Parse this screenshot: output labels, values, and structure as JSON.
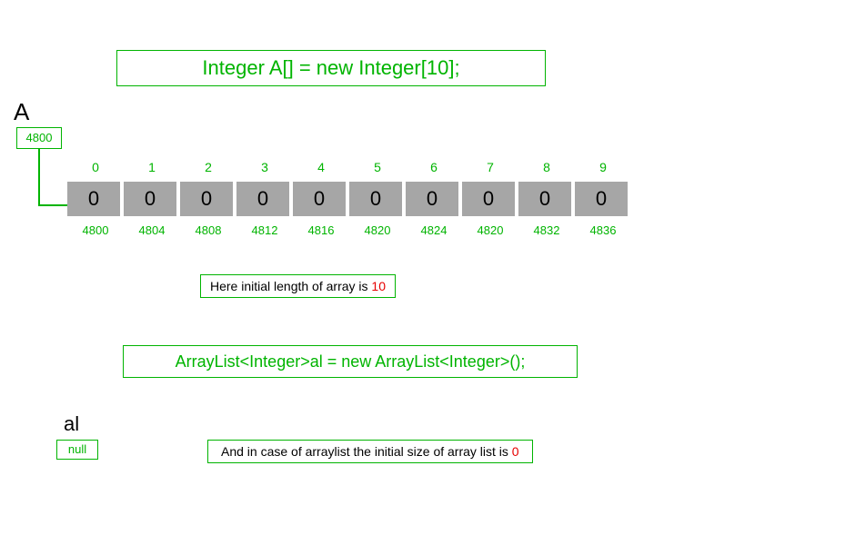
{
  "code1": "Integer A[] = new Integer[10];",
  "labelA": "A",
  "pointer_value": "4800",
  "indices": [
    "0",
    "1",
    "2",
    "3",
    "4",
    "5",
    "6",
    "7",
    "8",
    "9"
  ],
  "cells": [
    "0",
    "0",
    "0",
    "0",
    "0",
    "0",
    "0",
    "0",
    "0",
    "0"
  ],
  "addresses": [
    "4800",
    "4804",
    "4808",
    "4812",
    "4816",
    "4820",
    "4824",
    "4820",
    "4832",
    "4836"
  ],
  "note1_pre": "Here initial length of array  is ",
  "note1_val": "10",
  "code2": "ArrayList<Integer>al = new ArrayList<Integer>();",
  "label_al": "al",
  "null_text": "null",
  "note2_pre": "And in case of arraylist the initial size of array list is ",
  "note2_val": "0",
  "chart_data": {
    "type": "table",
    "title": "Java Integer array vs ArrayList initial state",
    "array_var": "A",
    "array_pointer_address": 4800,
    "array_length": 10,
    "array_indices": [
      0,
      1,
      2,
      3,
      4,
      5,
      6,
      7,
      8,
      9
    ],
    "array_values": [
      0,
      0,
      0,
      0,
      0,
      0,
      0,
      0,
      0,
      0
    ],
    "array_element_addresses": [
      4800,
      4804,
      4808,
      4812,
      4816,
      4820,
      4824,
      4820,
      4832,
      4836
    ],
    "arraylist_var": "al",
    "arraylist_initial_size": 0,
    "arraylist_state": "null"
  }
}
